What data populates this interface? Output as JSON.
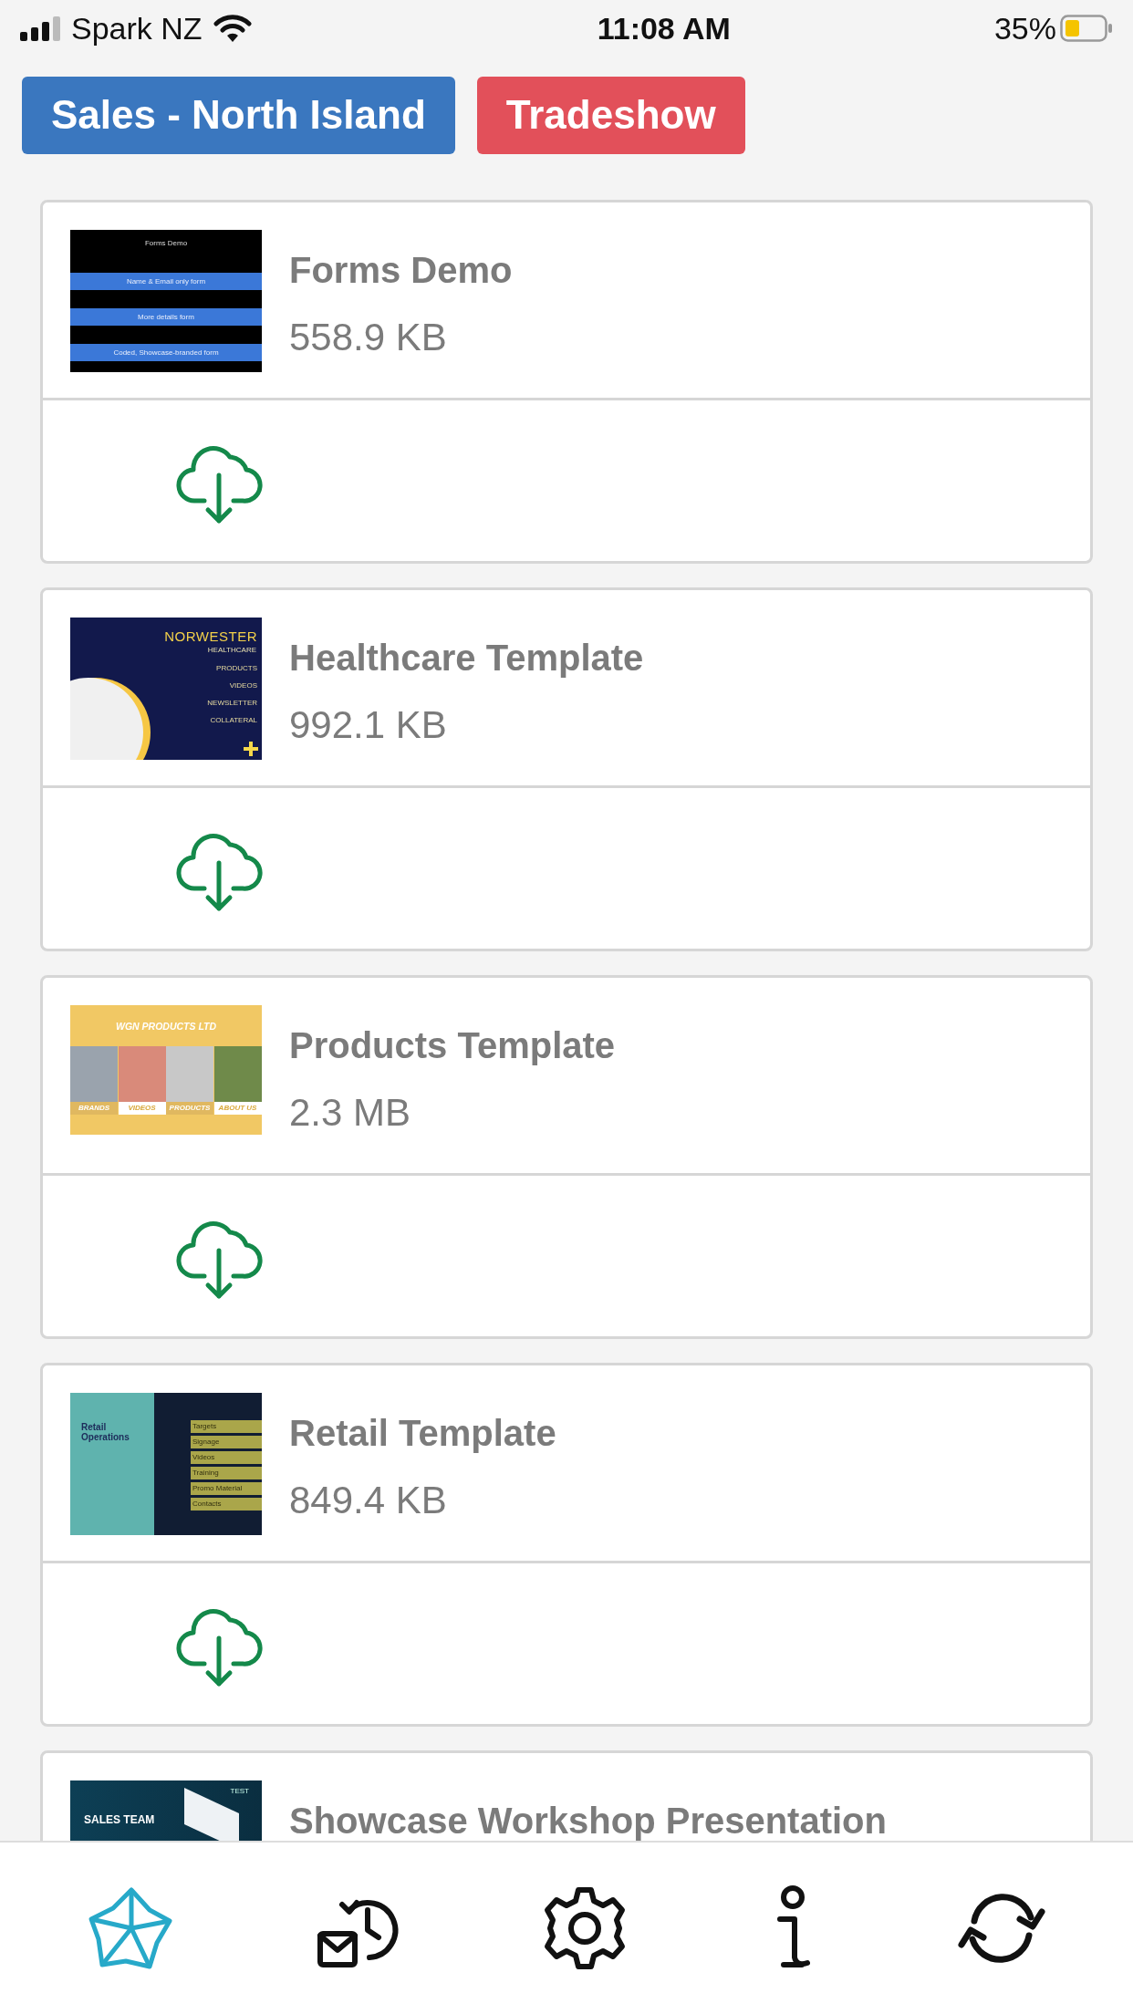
{
  "status_bar": {
    "carrier": "Spark NZ",
    "time": "11:08 AM",
    "battery": "35%"
  },
  "tabs": [
    {
      "label": "Sales - North Island",
      "color": "#3a77bf"
    },
    {
      "label": "Tradeshow",
      "color": "#e2505a"
    }
  ],
  "files": [
    {
      "title": "Forms Demo",
      "size": "558.9 KB",
      "thumbnail": {
        "kind": "forms",
        "heading": "Forms Demo",
        "items": [
          "Name & Email only form",
          "More details form",
          "Coded, Showcase-branded form"
        ]
      }
    },
    {
      "title": "Healthcare Template",
      "size": "992.1 KB",
      "thumbnail": {
        "kind": "healthcare",
        "heading": "NORWESTER",
        "subheading": "HEALTHCARE",
        "items": [
          "PRODUCTS",
          "VIDEOS",
          "NEWSLETTER",
          "COLLATERAL"
        ]
      }
    },
    {
      "title": "Products Template",
      "size": "2.3 MB",
      "thumbnail": {
        "kind": "products",
        "heading": "WGN PRODUCTS LTD",
        "items": [
          "BRANDS",
          "VIDEOS",
          "PRODUCTS",
          "ABOUT US"
        ]
      }
    },
    {
      "title": "Retail Template",
      "size": "849.4 KB",
      "thumbnail": {
        "kind": "retail",
        "heading": "Retail Operations",
        "items": [
          "Targets",
          "Signage",
          "Videos",
          "Training",
          "Promo Material",
          "Contacts"
        ]
      }
    },
    {
      "title": "Showcase Workshop Presentation",
      "thumbnail": {
        "kind": "sales",
        "heading": "SALES TEAM",
        "subheading": "TEST"
      }
    }
  ]
}
